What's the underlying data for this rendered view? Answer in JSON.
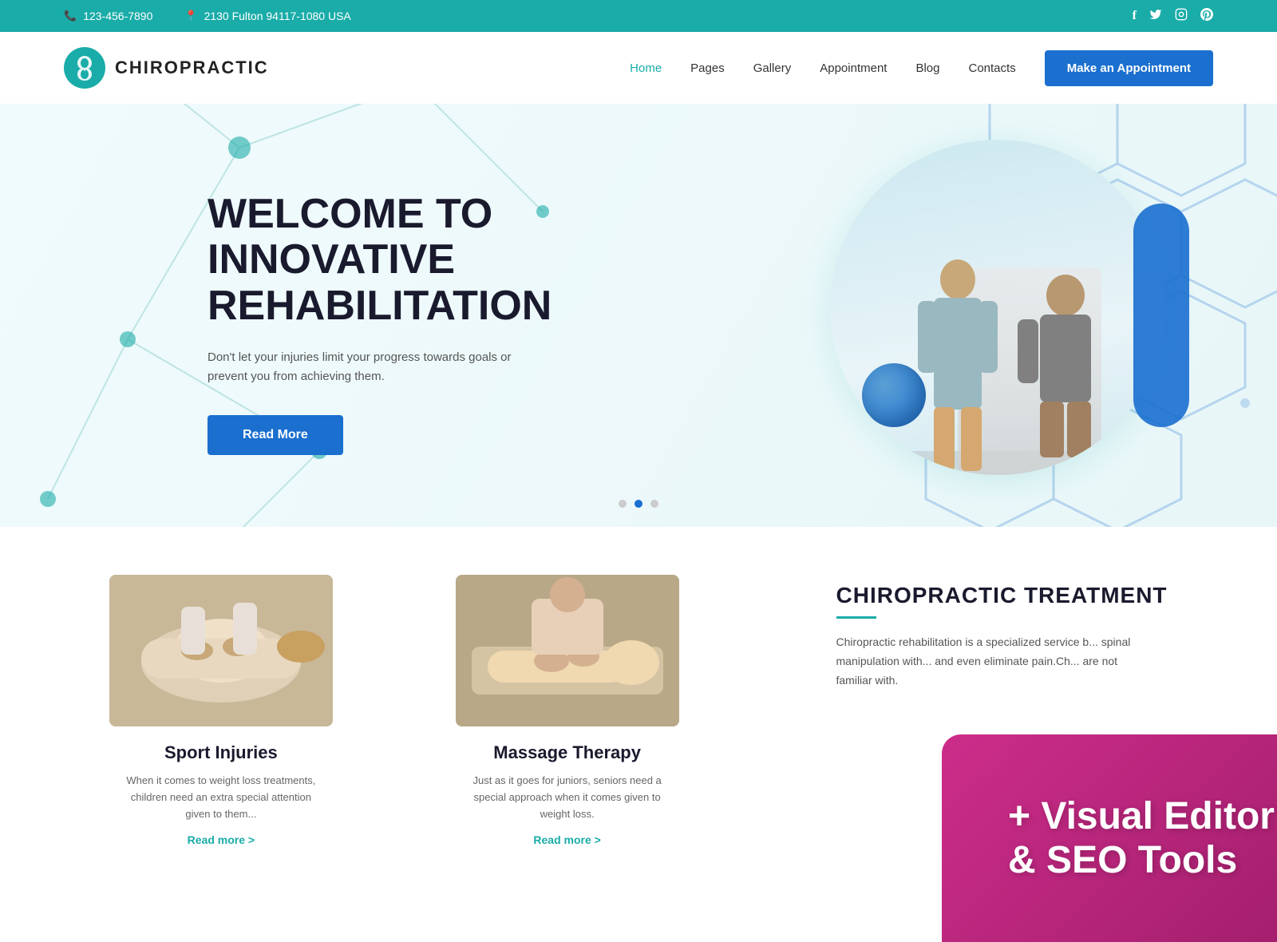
{
  "topbar": {
    "phone": "123-456-7890",
    "address": "2130 Fulton  94117-1080 USA",
    "phone_icon": "📞",
    "location_icon": "📍"
  },
  "social": {
    "facebook": "f",
    "twitter": "t",
    "instagram": "ig",
    "pinterest": "p"
  },
  "header": {
    "logo_text": "CHIROPRACTIC",
    "nav": [
      {
        "label": "Home",
        "active": true
      },
      {
        "label": "Pages",
        "active": false
      },
      {
        "label": "Gallery",
        "active": false
      },
      {
        "label": "Appointment",
        "active": false
      },
      {
        "label": "Blog",
        "active": false
      },
      {
        "label": "Contacts",
        "active": false
      }
    ],
    "cta_button": "Make an Appointment"
  },
  "hero": {
    "title": "WELCOME TO INNOVATIVE REHABILITATION",
    "description": "Don't let your injuries limit your progress towards goals or prevent you from achieving them.",
    "read_more": "Read More",
    "dots": [
      1,
      2,
      3
    ]
  },
  "services": {
    "sport": {
      "title": "Sport Injuries",
      "description": "When it comes to weight loss treatments, children need an extra special attention given to them...",
      "read_more": "Read more >"
    },
    "massage": {
      "title": "Massage Therapy",
      "description": "Just as it goes for juniors, seniors need a special approach when it comes given to weight loss.",
      "read_more": "Read more >"
    }
  },
  "chiropractic": {
    "title": "CHIROPRACTIC TREATMENT",
    "text": "Chiropractic rehabilitation is a specialized service b... spinal manipulation with... and even eliminate pain.Ch... are not familiar with."
  },
  "promo": {
    "line1": "+ Visual Editor",
    "line2": "& SEO Tools"
  }
}
